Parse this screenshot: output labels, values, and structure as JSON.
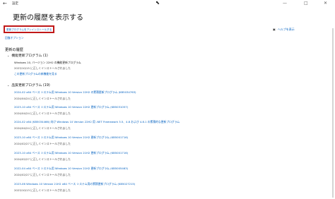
{
  "window": {
    "app_title": "設定",
    "back_glyph": "←",
    "minimize": "—",
    "maximize": "□",
    "close": "✕"
  },
  "page_title": "更新の履歴を表示する",
  "links": {
    "uninstall": "更新プログラムをアンインストールする",
    "recovery": "回復オプション",
    "help": "ヘルプを表示"
  },
  "history_title": "更新の履歴",
  "feature": {
    "label": "機能更新プログラム (1)",
    "items": [
      {
        "title": "Windows 10, バージョン 22H2 の機能更新プログラム",
        "status": "2023/10/15 に正しくインストールされました"
      }
    ],
    "more": "この更新プログラムの新機能を見る"
  },
  "quality": {
    "label": "品質更新プログラム (19)",
    "items": [
      {
        "title": "2024-02 x64 ベース システム用 Windows 10 Version 22H2 の累積更新プログラム (KB5034763)",
        "status": "2024/04/24 に正しくインストールされました"
      },
      {
        "title": "2023-10 x64 ベース システム用 Windows 10 Version 22H2 更新プログラム (KB5031057)",
        "status": "2024/04/24 に正しくインストールされました"
      },
      {
        "title": "2024-02 x64 (KB5034466) 向け Windows 10 Version 22H2 用 .NET Framework 3.5、4.8 および 4.8.1 の累積的な更新プログラム",
        "status": "2024/04/24 に正しくインストールされました"
      },
      {
        "title": "2023-10 x64 ベース システム用 Windows 10 Version 21H2 更新プログラム (KB5001716)",
        "status": "2024/02/27 に正しくインストールされました"
      },
      {
        "title": "2023-10 x64 ベース システム用 Windows 10 Version 21H2 更新プログラム (KB5001716)",
        "status": "2024/02/27 に正しくインストールされました"
      },
      {
        "title": "2022-04 x64 ベース システム用 Windows 10 Version 21H2 更新プログラム (KB5005463)",
        "status": "2024/02/27 に正しくインストールされました"
      },
      {
        "title": "2023-06 Windows 10 Version 21H2 x64 ベース システム用の累積更新プログラム (KB5027215)",
        "status": "2023/10/13 に正しくインストールされました"
      }
    ]
  }
}
